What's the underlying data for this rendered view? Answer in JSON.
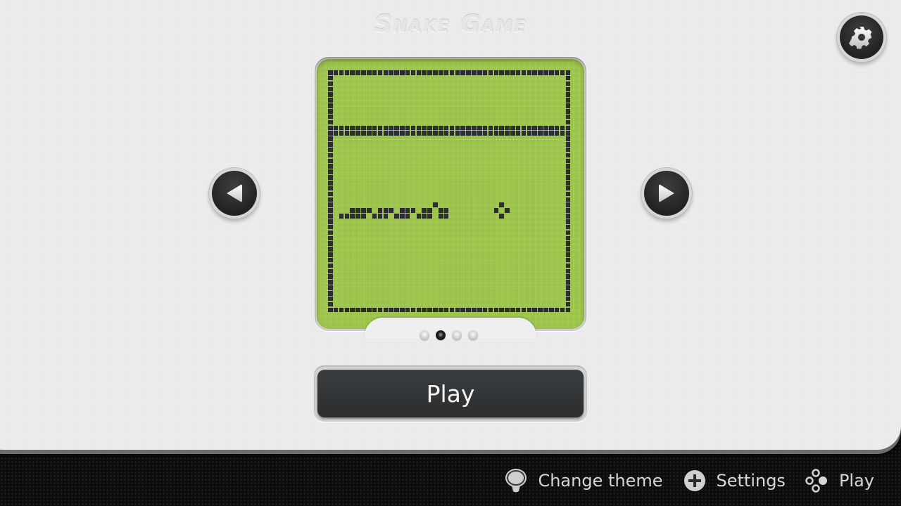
{
  "app": {
    "title": "Snake Game"
  },
  "header": {
    "settings_icon": "gear-icon"
  },
  "navigation": {
    "prev_icon": "triangle-left-icon",
    "next_icon": "triangle-right-icon"
  },
  "preview": {
    "screen_color": "#9cc34a",
    "pixel_color": "#2d2f33",
    "grid": {
      "columns": 44,
      "rows": 44
    },
    "border": true,
    "separator_rows": [
      10,
      11
    ],
    "snake_cells": [
      [
        2,
        26
      ],
      [
        3,
        26
      ],
      [
        4,
        26
      ],
      [
        5,
        26
      ],
      [
        6,
        26
      ],
      [
        4,
        25
      ],
      [
        5,
        25
      ],
      [
        6,
        25
      ],
      [
        7,
        25
      ],
      [
        8,
        26
      ],
      [
        9,
        26
      ],
      [
        10,
        26
      ],
      [
        9,
        25
      ],
      [
        10,
        25
      ],
      [
        11,
        25
      ],
      [
        12,
        26
      ],
      [
        13,
        26
      ],
      [
        14,
        26
      ],
      [
        13,
        25
      ],
      [
        14,
        25
      ],
      [
        15,
        25
      ],
      [
        16,
        26
      ],
      [
        17,
        26
      ],
      [
        18,
        26
      ],
      [
        17,
        25
      ],
      [
        18,
        25
      ],
      [
        19,
        24
      ],
      [
        20,
        25
      ],
      [
        21,
        25
      ],
      [
        20,
        26
      ],
      [
        21,
        26
      ]
    ],
    "food_cells": [
      [
        31,
        24
      ],
      [
        30,
        25
      ],
      [
        32,
        25
      ],
      [
        31,
        26
      ]
    ]
  },
  "pager": {
    "count": 4,
    "active_index": 1
  },
  "play_button": {
    "label": "Play"
  },
  "footer": {
    "items": [
      {
        "icon": "balloon-icon",
        "label": "Change theme"
      },
      {
        "icon": "plus-circle-icon",
        "label": "Settings"
      },
      {
        "icon": "gamepad-buttons-icon",
        "label": "Play"
      }
    ]
  }
}
